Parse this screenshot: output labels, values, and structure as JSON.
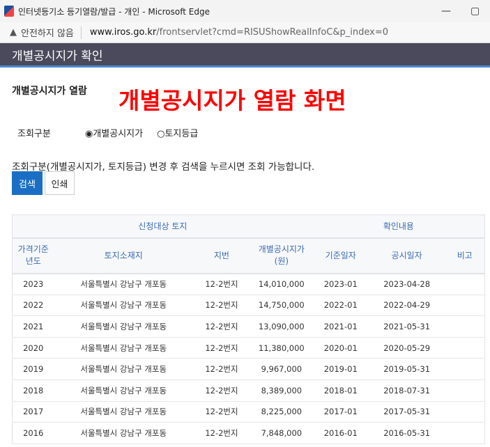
{
  "window": {
    "title": "인터넷등기소 등기열람/발급 - 개인 - Microsoft Edge",
    "minimize": "—",
    "maximize": "▢"
  },
  "address": {
    "security": "안전하지 않음",
    "domain": "www.iros.go.kr",
    "path": "/frontservlet?cmd=RISUShowRealInfoC&p_index=0"
  },
  "header": {
    "title": "개별공시지가 확인"
  },
  "section": {
    "title": "개별공시지가 열람",
    "annotation": "개별공시지가 열람 화면"
  },
  "query": {
    "label": "조회구분",
    "options": [
      {
        "label": "◉개별공시지가",
        "selected": true
      },
      {
        "label": "○토지등급",
        "selected": false
      }
    ]
  },
  "note": "조회구분(개별공시지가, 토지등급) 변경 후 검색을 누르시면 조회 가능합니다.",
  "buttons": {
    "search": "검색",
    "print": "인쇄"
  },
  "table": {
    "group_headers": [
      "신청대상 토지",
      "확인내용"
    ],
    "columns": [
      "가격기준\n년도",
      "토지소재지",
      "지번",
      "개별공시지가\n(원)",
      "기준일자",
      "공시일자",
      "비고"
    ],
    "rows": [
      [
        "2023",
        "서울특별시 강남구 개포동",
        "12-2번지",
        "14,010,000",
        "2023-01",
        "2023-04-28",
        ""
      ],
      [
        "2022",
        "서울특별시 강남구 개포동",
        "12-2번지",
        "14,750,000",
        "2022-01",
        "2022-04-29",
        ""
      ],
      [
        "2021",
        "서울특별시 강남구 개포동",
        "12-2번지",
        "13,090,000",
        "2021-01",
        "2021-05-31",
        ""
      ],
      [
        "2020",
        "서울특별시 강남구 개포동",
        "12-2번지",
        "11,380,000",
        "2020-01",
        "2020-05-29",
        ""
      ],
      [
        "2019",
        "서울특별시 강남구 개포동",
        "12-2번지",
        "9,967,000",
        "2019-01",
        "2019-05-31",
        ""
      ],
      [
        "2018",
        "서울특별시 강남구 개포동",
        "12-2번지",
        "8,389,000",
        "2018-01",
        "2018-07-31",
        ""
      ],
      [
        "2017",
        "서울특별시 강남구 개포동",
        "12-2번지",
        "8,225,000",
        "2017-01",
        "2017-05-31",
        ""
      ],
      [
        "2016",
        "서울특별시 강남구 개포동",
        "12-2번지",
        "7,848,000",
        "2016-01",
        "2016-05-31",
        ""
      ]
    ]
  }
}
